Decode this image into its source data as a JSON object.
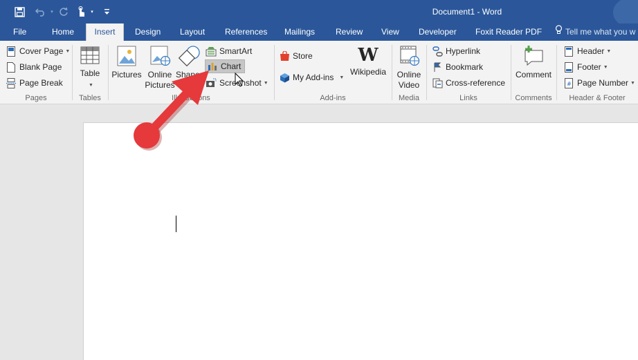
{
  "window": {
    "title": "Document1 - Word"
  },
  "quick_access": {
    "save_icon": "save-icon",
    "undo_icon": "undo-icon",
    "redo_icon": "redo-icon",
    "touch_icon": "touch-mode-icon",
    "customize_icon": "customize-qat-icon"
  },
  "tabs": {
    "file": "File",
    "home": "Home",
    "insert": "Insert",
    "design": "Design",
    "layout": "Layout",
    "references": "References",
    "mailings": "Mailings",
    "review": "Review",
    "view": "View",
    "developer": "Developer",
    "foxit": "Foxit Reader PDF",
    "tell_me": "Tell me what you w"
  },
  "ribbon": {
    "pages": {
      "label": "Pages",
      "cover_page": "Cover Page",
      "blank_page": "Blank Page",
      "page_break": "Page Break"
    },
    "tables": {
      "label": "Tables",
      "table": "Table"
    },
    "illustrations": {
      "label": "Illustrations",
      "pictures": "Pictures",
      "online_pictures_line1": "Online",
      "online_pictures_line2": "Pictures",
      "shapes": "Shapes",
      "smartart": "SmartArt",
      "chart": "Chart",
      "screenshot": "Screenshot"
    },
    "addins": {
      "label": "Add-ins",
      "store": "Store",
      "my_addins": "My Add-ins",
      "wikipedia": "Wikipedia"
    },
    "media": {
      "label": "Media",
      "online_video_line1": "Online",
      "online_video_line2": "Video"
    },
    "links": {
      "label": "Links",
      "hyperlink": "Hyperlink",
      "bookmark": "Bookmark",
      "cross_reference": "Cross-reference"
    },
    "comments": {
      "label": "Comments",
      "comment": "Comment"
    },
    "header_footer": {
      "label": "Header & Footer",
      "header": "Header",
      "footer": "Footer",
      "page_number": "Page Number"
    }
  },
  "colors": {
    "title_bar": "#2b579a",
    "annotation_arrow": "#e5393b"
  }
}
